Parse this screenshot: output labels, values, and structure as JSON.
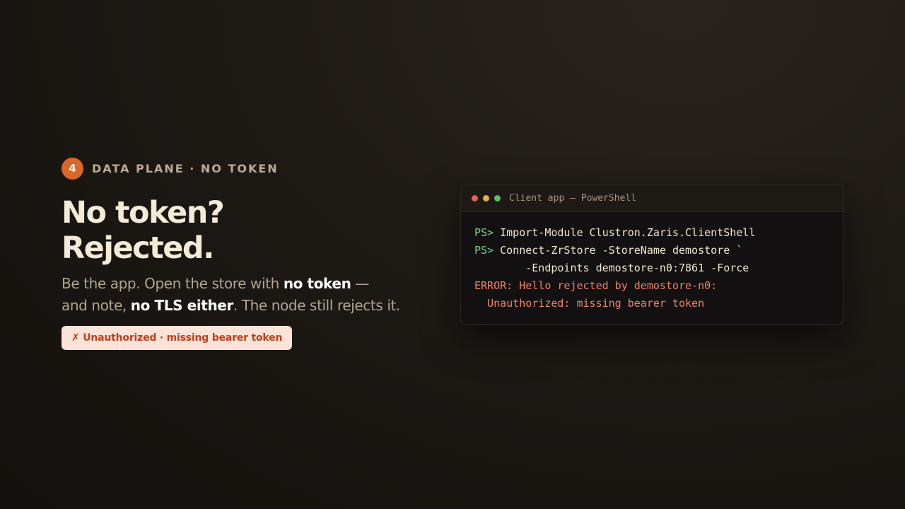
{
  "step": {
    "number": "4",
    "label": "DATA PLANE · NO TOKEN"
  },
  "title": {
    "line1": "No token?",
    "line2": "Rejected."
  },
  "subtitle": {
    "part1": "Be the app. Open the store with ",
    "bold1": "no token",
    "part2": " —",
    "part3": "and note, ",
    "bold2": "no TLS either",
    "part4": ". The node still rejects it."
  },
  "error_pill": "✗ Unauthorized · missing bearer token",
  "terminal": {
    "title": "Client app — PowerShell",
    "prompt": "PS>",
    "line1_cmd": " Import-Module Clustron.Zaris.ClientShell",
    "line2_cmd": " Connect-ZrStore -StoreName demostore `",
    "line3": "        -Endpoints demostore-n0:7861 -Force",
    "error_line1": "ERROR: Hello rejected by demostore-n0:",
    "error_line2": "  Unauthorized: missing bearer token"
  },
  "colors": {
    "accent": "#d8682a",
    "prompt": "#7ed08a",
    "error": "#f0826a",
    "pill_bg": "#fbe3d8",
    "pill_text": "#bf3e1d"
  },
  "icons": {
    "window_controls": [
      "close-dot",
      "minimize-dot",
      "maximize-dot"
    ],
    "error_mark": "cross-icon"
  }
}
